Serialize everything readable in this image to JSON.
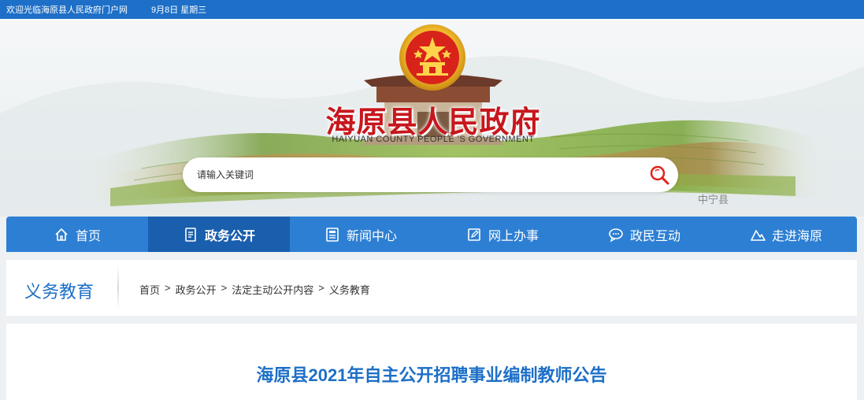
{
  "topbar": {
    "welcome": "欢迎光临海原县人民政府门户网",
    "date": "9月8日 星期三"
  },
  "banner": {
    "title": "海原县人民政府",
    "subtitle": "HAIYUAN COUNTY PEOPLE 'S GOVERNMENT",
    "county_label": "中宁县",
    "emblem_icon": "national-emblem-icon"
  },
  "search": {
    "placeholder": "请输入关键词",
    "icon": "search-icon"
  },
  "nav": {
    "items": [
      {
        "label": "首页",
        "icon": "home-icon",
        "active": false
      },
      {
        "label": "政务公开",
        "icon": "document-icon",
        "active": true
      },
      {
        "label": "新闻中心",
        "icon": "news-icon",
        "active": false
      },
      {
        "label": "网上办事",
        "icon": "edit-icon",
        "active": false
      },
      {
        "label": "政民互动",
        "icon": "chat-icon",
        "active": false
      },
      {
        "label": "走进海原",
        "icon": "mountain-icon",
        "active": false
      }
    ]
  },
  "section": {
    "title": "义务教育"
  },
  "breadcrumb": {
    "items": [
      "首页",
      "政务公开",
      "法定主动公开内容",
      "义务教育"
    ],
    "separator": ">"
  },
  "article": {
    "title": "海原县2021年自主公开招聘事业编制教师公告"
  },
  "colors": {
    "brand_blue": "#1d6fc7",
    "nav_blue": "#2d7fd3",
    "nav_active": "#1a5fae",
    "title_red": "#c8161d"
  }
}
